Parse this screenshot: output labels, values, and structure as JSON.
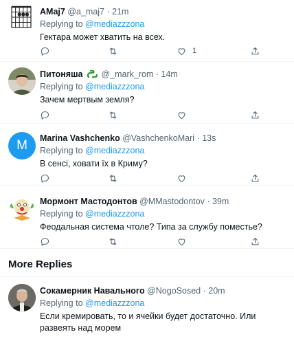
{
  "tweets": [
    {
      "name": "AMaj7",
      "handle": "@a_maj7",
      "dot": "·",
      "time": "21m",
      "replying_prefix": "Replying to ",
      "replying_to": "@mediazzzona",
      "text": "Гектара может хватить на всех.",
      "like_count": "1"
    },
    {
      "name": "Питоняша",
      "name_emoji_icon": "snake-emoji-icon",
      "handle": "@_mark_rom",
      "dot": "·",
      "time": "14m",
      "replying_prefix": "Replying to ",
      "replying_to": "@mediazzzona",
      "text": "Зачем мертвым земля?",
      "like_count": ""
    },
    {
      "name": "Marina Vashchenko",
      "handle": "@VashchenkoMari",
      "dot": "·",
      "time": "13s",
      "avatar_letter": "M",
      "replying_prefix": "Replying to ",
      "replying_to": "@mediazzzona",
      "text": "В сенсі, ховати їх в Криму?",
      "like_count": ""
    },
    {
      "name": "Мормонт Мастодонтов",
      "handle": "@MMastodontov",
      "dot": "·",
      "time": "39m",
      "replying_prefix": "Replying to ",
      "replying_to": "@mediazzzona",
      "text": "Феодальная система чтоле? Типа за службу поместье?",
      "like_count": ""
    },
    {
      "name": "Сокамерник Навального",
      "handle": "@NogoSosed",
      "dot": "·",
      "time": "20m",
      "replying_prefix": "Replying to ",
      "replying_to": "@mediazzzona",
      "text": "Если кремировать, то и ячейки будет достаточно. Или развеять над морем",
      "like_count": ""
    }
  ],
  "more_replies_label": "More Replies",
  "colors": {
    "accent": "#1d9bf0",
    "secondary_text": "#536471",
    "marina_avatar": "#1d9bf0"
  },
  "icons": [
    "reply-icon",
    "retweet-icon",
    "like-icon",
    "share-icon"
  ]
}
